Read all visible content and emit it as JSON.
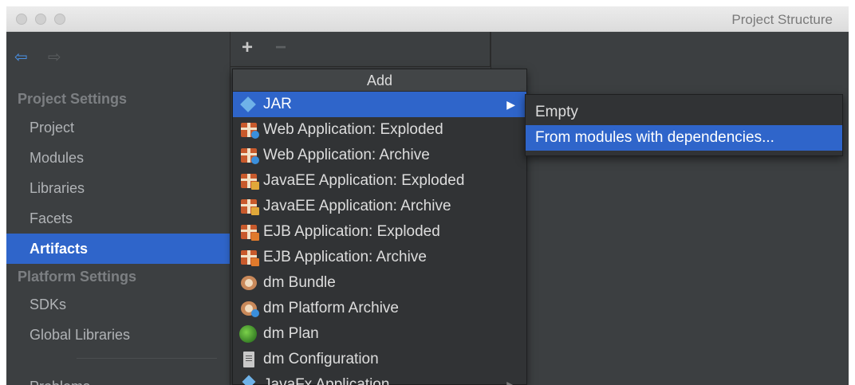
{
  "window": {
    "title": "Project Structure"
  },
  "sidebar": {
    "project_settings_header": "Project Settings",
    "platform_settings_header": "Platform Settings",
    "items": [
      {
        "label": "Project"
      },
      {
        "label": "Modules"
      },
      {
        "label": "Libraries"
      },
      {
        "label": "Facets"
      },
      {
        "label": "Artifacts",
        "selected": true
      },
      {
        "label": "SDKs"
      },
      {
        "label": "Global Libraries"
      },
      {
        "label": "Problems"
      }
    ]
  },
  "toolbar": {
    "add_label": "+",
    "remove_label": "−",
    "back_icon": "back-arrow-icon",
    "forward_icon": "forward-arrow-icon"
  },
  "add_menu": {
    "header": "Add",
    "items": [
      {
        "label": "JAR",
        "icon": "jar-icon",
        "submenu": true,
        "active": true
      },
      {
        "label": "Web Application: Exploded",
        "icon": "web-app-icon"
      },
      {
        "label": "Web Application: Archive",
        "icon": "web-app-icon"
      },
      {
        "label": "JavaEE Application: Exploded",
        "icon": "javaee-app-icon"
      },
      {
        "label": "JavaEE Application: Archive",
        "icon": "javaee-app-icon"
      },
      {
        "label": "EJB Application: Exploded",
        "icon": "ejb-app-icon"
      },
      {
        "label": "EJB Application: Archive",
        "icon": "ejb-app-icon"
      },
      {
        "label": "dm Bundle",
        "icon": "bundle-icon"
      },
      {
        "label": "dm Platform Archive",
        "icon": "platform-archive-icon"
      },
      {
        "label": "dm Plan",
        "icon": "plan-icon"
      },
      {
        "label": "dm Configuration",
        "icon": "configuration-icon"
      },
      {
        "label": "JavaFx Application",
        "icon": "javafx-icon",
        "submenu": true
      }
    ]
  },
  "jar_submenu": {
    "items": [
      {
        "label": "Empty"
      },
      {
        "label": "From modules with dependencies...",
        "active": true
      }
    ]
  },
  "colors": {
    "selection": "#2f65ca",
    "background": "#3c3f41",
    "menu": "#313335"
  }
}
